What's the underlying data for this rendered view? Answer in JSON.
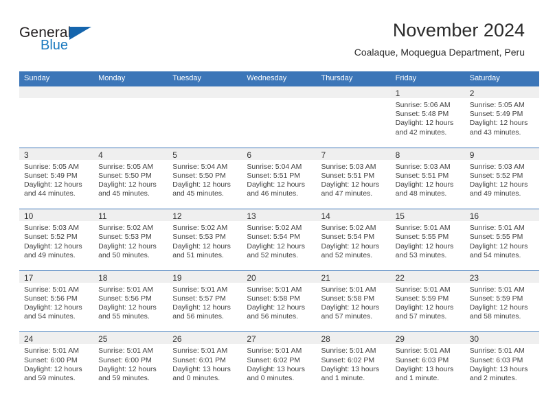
{
  "brand": {
    "name_part1": "General",
    "name_part2": "Blue",
    "triangle_icon": "triangle-icon",
    "color_primary": "#1565ad",
    "color_text": "#231f20"
  },
  "header": {
    "month_title": "November 2024",
    "location": "Coalaque, Moquegua Department, Peru"
  },
  "theme": {
    "header_blue": "#3c76b8",
    "daynum_band": "#efefef",
    "text": "#404040"
  },
  "weekdays": [
    "Sunday",
    "Monday",
    "Tuesday",
    "Wednesday",
    "Thursday",
    "Friday",
    "Saturday"
  ],
  "weeks": [
    [
      {
        "day": "",
        "lines": []
      },
      {
        "day": "",
        "lines": []
      },
      {
        "day": "",
        "lines": []
      },
      {
        "day": "",
        "lines": []
      },
      {
        "day": "",
        "lines": []
      },
      {
        "day": "1",
        "lines": [
          "Sunrise: 5:06 AM",
          "Sunset: 5:48 PM",
          "Daylight: 12 hours",
          "and 42 minutes."
        ]
      },
      {
        "day": "2",
        "lines": [
          "Sunrise: 5:05 AM",
          "Sunset: 5:49 PM",
          "Daylight: 12 hours",
          "and 43 minutes."
        ]
      }
    ],
    [
      {
        "day": "3",
        "lines": [
          "Sunrise: 5:05 AM",
          "Sunset: 5:49 PM",
          "Daylight: 12 hours",
          "and 44 minutes."
        ]
      },
      {
        "day": "4",
        "lines": [
          "Sunrise: 5:05 AM",
          "Sunset: 5:50 PM",
          "Daylight: 12 hours",
          "and 45 minutes."
        ]
      },
      {
        "day": "5",
        "lines": [
          "Sunrise: 5:04 AM",
          "Sunset: 5:50 PM",
          "Daylight: 12 hours",
          "and 45 minutes."
        ]
      },
      {
        "day": "6",
        "lines": [
          "Sunrise: 5:04 AM",
          "Sunset: 5:51 PM",
          "Daylight: 12 hours",
          "and 46 minutes."
        ]
      },
      {
        "day": "7",
        "lines": [
          "Sunrise: 5:03 AM",
          "Sunset: 5:51 PM",
          "Daylight: 12 hours",
          "and 47 minutes."
        ]
      },
      {
        "day": "8",
        "lines": [
          "Sunrise: 5:03 AM",
          "Sunset: 5:51 PM",
          "Daylight: 12 hours",
          "and 48 minutes."
        ]
      },
      {
        "day": "9",
        "lines": [
          "Sunrise: 5:03 AM",
          "Sunset: 5:52 PM",
          "Daylight: 12 hours",
          "and 49 minutes."
        ]
      }
    ],
    [
      {
        "day": "10",
        "lines": [
          "Sunrise: 5:03 AM",
          "Sunset: 5:52 PM",
          "Daylight: 12 hours",
          "and 49 minutes."
        ]
      },
      {
        "day": "11",
        "lines": [
          "Sunrise: 5:02 AM",
          "Sunset: 5:53 PM",
          "Daylight: 12 hours",
          "and 50 minutes."
        ]
      },
      {
        "day": "12",
        "lines": [
          "Sunrise: 5:02 AM",
          "Sunset: 5:53 PM",
          "Daylight: 12 hours",
          "and 51 minutes."
        ]
      },
      {
        "day": "13",
        "lines": [
          "Sunrise: 5:02 AM",
          "Sunset: 5:54 PM",
          "Daylight: 12 hours",
          "and 52 minutes."
        ]
      },
      {
        "day": "14",
        "lines": [
          "Sunrise: 5:02 AM",
          "Sunset: 5:54 PM",
          "Daylight: 12 hours",
          "and 52 minutes."
        ]
      },
      {
        "day": "15",
        "lines": [
          "Sunrise: 5:01 AM",
          "Sunset: 5:55 PM",
          "Daylight: 12 hours",
          "and 53 minutes."
        ]
      },
      {
        "day": "16",
        "lines": [
          "Sunrise: 5:01 AM",
          "Sunset: 5:55 PM",
          "Daylight: 12 hours",
          "and 54 minutes."
        ]
      }
    ],
    [
      {
        "day": "17",
        "lines": [
          "Sunrise: 5:01 AM",
          "Sunset: 5:56 PM",
          "Daylight: 12 hours",
          "and 54 minutes."
        ]
      },
      {
        "day": "18",
        "lines": [
          "Sunrise: 5:01 AM",
          "Sunset: 5:56 PM",
          "Daylight: 12 hours",
          "and 55 minutes."
        ]
      },
      {
        "day": "19",
        "lines": [
          "Sunrise: 5:01 AM",
          "Sunset: 5:57 PM",
          "Daylight: 12 hours",
          "and 56 minutes."
        ]
      },
      {
        "day": "20",
        "lines": [
          "Sunrise: 5:01 AM",
          "Sunset: 5:58 PM",
          "Daylight: 12 hours",
          "and 56 minutes."
        ]
      },
      {
        "day": "21",
        "lines": [
          "Sunrise: 5:01 AM",
          "Sunset: 5:58 PM",
          "Daylight: 12 hours",
          "and 57 minutes."
        ]
      },
      {
        "day": "22",
        "lines": [
          "Sunrise: 5:01 AM",
          "Sunset: 5:59 PM",
          "Daylight: 12 hours",
          "and 57 minutes."
        ]
      },
      {
        "day": "23",
        "lines": [
          "Sunrise: 5:01 AM",
          "Sunset: 5:59 PM",
          "Daylight: 12 hours",
          "and 58 minutes."
        ]
      }
    ],
    [
      {
        "day": "24",
        "lines": [
          "Sunrise: 5:01 AM",
          "Sunset: 6:00 PM",
          "Daylight: 12 hours",
          "and 59 minutes."
        ]
      },
      {
        "day": "25",
        "lines": [
          "Sunrise: 5:01 AM",
          "Sunset: 6:00 PM",
          "Daylight: 12 hours",
          "and 59 minutes."
        ]
      },
      {
        "day": "26",
        "lines": [
          "Sunrise: 5:01 AM",
          "Sunset: 6:01 PM",
          "Daylight: 13 hours",
          "and 0 minutes."
        ]
      },
      {
        "day": "27",
        "lines": [
          "Sunrise: 5:01 AM",
          "Sunset: 6:02 PM",
          "Daylight: 13 hours",
          "and 0 minutes."
        ]
      },
      {
        "day": "28",
        "lines": [
          "Sunrise: 5:01 AM",
          "Sunset: 6:02 PM",
          "Daylight: 13 hours",
          "and 1 minute."
        ]
      },
      {
        "day": "29",
        "lines": [
          "Sunrise: 5:01 AM",
          "Sunset: 6:03 PM",
          "Daylight: 13 hours",
          "and 1 minute."
        ]
      },
      {
        "day": "30",
        "lines": [
          "Sunrise: 5:01 AM",
          "Sunset: 6:03 PM",
          "Daylight: 13 hours",
          "and 2 minutes."
        ]
      }
    ]
  ]
}
